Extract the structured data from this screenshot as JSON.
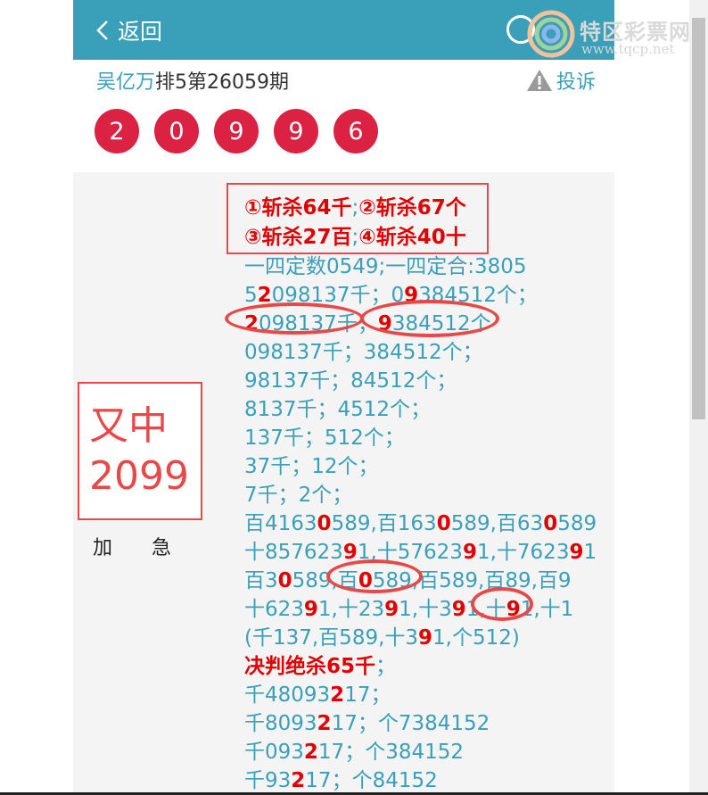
{
  "header": {
    "back_label": "返回"
  },
  "watermark": {
    "title": "特区彩票网",
    "url": "www.tqcp.net"
  },
  "info": {
    "author": "吴亿万",
    "period": "排5第26059期",
    "report_label": "投诉"
  },
  "balls": [
    "2",
    "0",
    "9",
    "9",
    "6"
  ],
  "colors": {
    "accent": "#3a9fb9",
    "ball": "#dc2242",
    "highlight": "#e00000",
    "box_border": "#e84848"
  },
  "left_panel": {
    "line1": "又中",
    "line2": "2099",
    "urgent": "加急"
  },
  "content": {
    "kill_line1": [
      {
        "t": "①斩杀64千",
        "c": "kill"
      },
      {
        "t": ";",
        "c": ""
      },
      {
        "t": "②斩杀67个",
        "c": "kill"
      }
    ],
    "kill_line2": [
      {
        "t": "③斩杀27百",
        "c": "kill"
      },
      {
        "t": ";",
        "c": ""
      },
      {
        "t": "④斩杀40十",
        "c": "kill"
      }
    ],
    "lines": [
      [
        {
          "t": "一四定数0549;一四定合:3805",
          "c": ""
        }
      ],
      [
        {
          "t": "5",
          "c": ""
        },
        {
          "t": "2",
          "c": "r"
        },
        {
          "t": "098137千；0",
          "c": ""
        },
        {
          "t": "9",
          "c": "r"
        },
        {
          "t": "384512个；",
          "c": ""
        }
      ],
      [
        {
          "t": "2",
          "c": "r"
        },
        {
          "t": "098137千；",
          "c": ""
        },
        {
          "t": "9",
          "c": "r"
        },
        {
          "t": "384512个",
          "c": ""
        }
      ],
      [
        {
          "t": "098137千；384512个；",
          "c": ""
        }
      ],
      [
        {
          "t": "98137千；84512个；",
          "c": ""
        }
      ],
      [
        {
          "t": "8137千；4512个；",
          "c": ""
        }
      ],
      [
        {
          "t": "137千；512个；",
          "c": ""
        }
      ],
      [
        {
          "t": "37千；12个；",
          "c": ""
        }
      ],
      [
        {
          "t": "7千；2个；",
          "c": ""
        }
      ],
      [
        {
          "t": "百4163",
          "c": ""
        },
        {
          "t": "0",
          "c": "r"
        },
        {
          "t": "589,百163",
          "c": ""
        },
        {
          "t": "0",
          "c": "r"
        },
        {
          "t": "589,百63",
          "c": ""
        },
        {
          "t": "0",
          "c": "r"
        },
        {
          "t": "589",
          "c": ""
        }
      ],
      [
        {
          "t": "十857623",
          "c": ""
        },
        {
          "t": "9",
          "c": "r"
        },
        {
          "t": "1,十57623",
          "c": ""
        },
        {
          "t": "9",
          "c": "r"
        },
        {
          "t": "1,十7623",
          "c": ""
        },
        {
          "t": "9",
          "c": "r"
        },
        {
          "t": "1",
          "c": ""
        }
      ],
      [
        {
          "t": "百3",
          "c": ""
        },
        {
          "t": "0",
          "c": "r"
        },
        {
          "t": "589,百",
          "c": ""
        },
        {
          "t": "0",
          "c": "r"
        },
        {
          "t": "589,百589,百89,百9",
          "c": ""
        }
      ],
      [
        {
          "t": "十623",
          "c": ""
        },
        {
          "t": "9",
          "c": "r"
        },
        {
          "t": "1,十23",
          "c": ""
        },
        {
          "t": "9",
          "c": "r"
        },
        {
          "t": "1,十3",
          "c": ""
        },
        {
          "t": "9",
          "c": "r"
        },
        {
          "t": "1,十",
          "c": ""
        },
        {
          "t": "9",
          "c": "r"
        },
        {
          "t": "1,十1",
          "c": ""
        }
      ],
      [
        {
          "t": "(千137,百589,十3",
          "c": ""
        },
        {
          "t": "9",
          "c": "r"
        },
        {
          "t": "1,个512)",
          "c": ""
        }
      ],
      [
        {
          "t": "决判绝杀65千",
          "c": "kill"
        },
        {
          "t": "；",
          "c": ""
        }
      ],
      [
        {
          "t": "千48093",
          "c": ""
        },
        {
          "t": "2",
          "c": "r"
        },
        {
          "t": "17；",
          "c": ""
        }
      ],
      [
        {
          "t": "千8093",
          "c": ""
        },
        {
          "t": "2",
          "c": "r"
        },
        {
          "t": "17；个7384152",
          "c": ""
        }
      ],
      [
        {
          "t": "千093",
          "c": ""
        },
        {
          "t": "2",
          "c": "r"
        },
        {
          "t": "17；个384152",
          "c": ""
        }
      ],
      [
        {
          "t": "千93",
          "c": ""
        },
        {
          "t": "2",
          "c": "r"
        },
        {
          "t": "17；个84152",
          "c": ""
        }
      ]
    ]
  }
}
